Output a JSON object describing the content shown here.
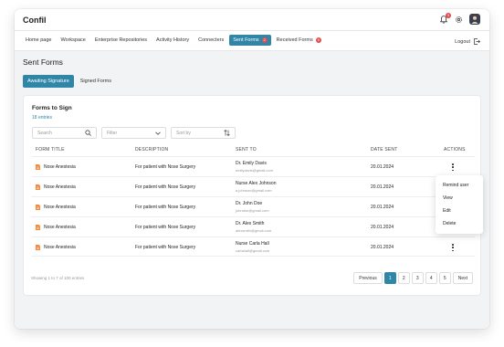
{
  "app": {
    "brand": "Confil",
    "bell_count": "3"
  },
  "nav": {
    "items": [
      {
        "label": "Home page"
      },
      {
        "label": "Workspace"
      },
      {
        "label": "Enterprise Repositories"
      },
      {
        "label": "Activity History"
      },
      {
        "label": "Connecters"
      },
      {
        "label": "Sent Forms",
        "badge": "2",
        "active": true
      },
      {
        "label": "Received Forms",
        "badge": "5"
      }
    ],
    "logout_label": "Logout"
  },
  "page": {
    "title": "Sent Forms",
    "tabs": [
      {
        "label": "Awaiting Signature",
        "active": true
      },
      {
        "label": "Signed Forms"
      }
    ]
  },
  "card": {
    "title": "Forms to Sign",
    "entries": "18 entries",
    "search_placeholder": "Search",
    "filter_placeholder": "Filter",
    "sort_placeholder": "Sort by"
  },
  "table": {
    "headers": {
      "form_title": "FORM TITLE",
      "description": "DESCRIPTION",
      "sent_to": "SENT TO",
      "date_sent": "DATE SENT",
      "actions": "ACTIONS"
    },
    "rows": [
      {
        "title": "Nose Anestesia",
        "description": "For patient with Nose Surgery",
        "name": "Dr. Emily Davis",
        "email": "emilydavis@gmail.com",
        "date": "20.01.2024"
      },
      {
        "title": "Nose Anestesia",
        "description": "For patient with Nose Surgery",
        "name": "Nurse Alex Johnson",
        "email": "a.johnson@gmail.com",
        "date": "20.01.2024"
      },
      {
        "title": "Nose Anestesia",
        "description": "For patient with Nose Surgery",
        "name": "Dr. John Doe",
        "email": "johndoe@gmail.com",
        "date": "20.01.2024"
      },
      {
        "title": "Nose Anestesia",
        "description": "For patient with Nose Surgery",
        "name": "Dr. Alex Smith",
        "email": "alexsmith@gmail.com",
        "date": "20.01.2024"
      },
      {
        "title": "Nose Anestesia",
        "description": "For patient with Nose Surgery",
        "name": "Nurse Carla Hall",
        "email": "carlahall@gmail.com",
        "date": "20.01.2024"
      }
    ]
  },
  "menu": {
    "items": [
      "Remind user",
      "View",
      "Edit",
      "Delete"
    ]
  },
  "footer": {
    "showing": "Showing 1 to 7 of 100 entries",
    "pages": [
      "Previous",
      "1",
      "2",
      "3",
      "4",
      "5",
      "Next"
    ]
  },
  "colors": {
    "accent": "#2f86a6",
    "badge": "#e24c4c",
    "file_icon": "#f08a3c"
  }
}
